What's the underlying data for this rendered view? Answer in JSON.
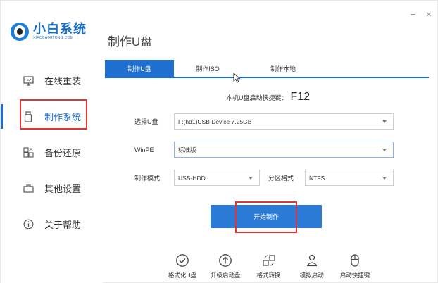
{
  "window": {
    "minimize_label": "−",
    "close_label": "×"
  },
  "logo": {
    "name_cn": "小白系统",
    "name_en": "XIAOBAIXITONG.COM",
    "icon": "logo-icon"
  },
  "sidebar": {
    "items": [
      {
        "label": "在线重装",
        "icon": "monitor-icon"
      },
      {
        "label": "制作系统",
        "icon": "usb-drive-icon",
        "active": true
      },
      {
        "label": "备份还原",
        "icon": "backup-icon"
      },
      {
        "label": "其他设置",
        "icon": "toolbox-icon"
      },
      {
        "label": "关于帮助",
        "icon": "info-icon"
      }
    ]
  },
  "main": {
    "title": "制作U盘",
    "tabs": [
      {
        "label": "制作U盘",
        "active": true
      },
      {
        "label": "制作ISO"
      },
      {
        "label": "制作本地"
      }
    ],
    "hotkey_label": "本机U盘启动快捷键：",
    "hotkey_value": "F12",
    "form": {
      "usb_label": "选择U盘",
      "usb_value": "F:(hd1)USB Device 7.25GB",
      "winpe_label": "WinPE",
      "winpe_value": "标准版",
      "mode_label": "制作模式",
      "mode_value": "USB-HDD",
      "partition_label": "分区格式",
      "partition_value": "NTFS"
    },
    "start_button": "开始制作"
  },
  "tools": [
    {
      "label": "格式化U盘",
      "icon": "check-circle-icon"
    },
    {
      "label": "升级启动盘",
      "icon": "upgrade-icon"
    },
    {
      "label": "格式转换",
      "icon": "convert-icon"
    },
    {
      "label": "模拟启动",
      "icon": "simulate-icon"
    },
    {
      "label": "启动快捷键",
      "icon": "mouse-icon"
    }
  ],
  "colors": {
    "accent": "#1e6fd0",
    "highlight": "#e03535",
    "button": "#2a7ad6"
  }
}
